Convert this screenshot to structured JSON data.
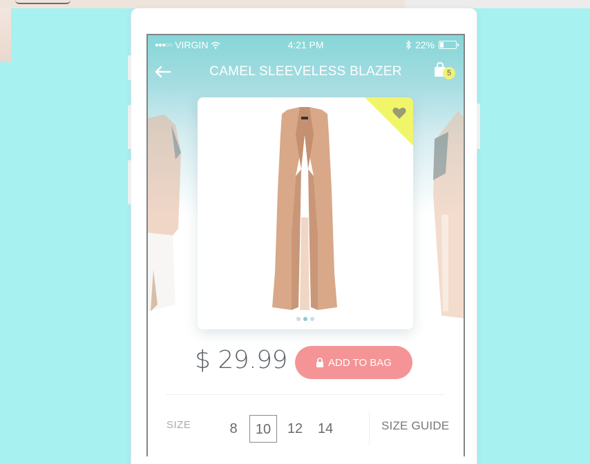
{
  "status_bar": {
    "signal": "●●●○○",
    "carrier": "VIRGIN",
    "time": "4:21 PM",
    "battery": "22%",
    "battery_level": 0.22
  },
  "nav": {
    "title": "CAMEL SLEEVELESS BLAZER",
    "bag_count": "5"
  },
  "product": {
    "price": "$ 29.99",
    "add_to_bag_label": "ADD TO BAG",
    "carousel_dots": 3,
    "carousel_active_index": 1
  },
  "size": {
    "label": "SIZE",
    "options": [
      "8",
      "10",
      "12",
      "14"
    ],
    "selected": "10",
    "guide_label": "SIZE GUIDE"
  },
  "colors": {
    "background": "#a8f1f1",
    "header_teal": "#86d6d7",
    "add_button": "#f49496",
    "favorite_corner": "#f1f56a",
    "badge": "#eef279",
    "product_camel": "#d8a889"
  }
}
